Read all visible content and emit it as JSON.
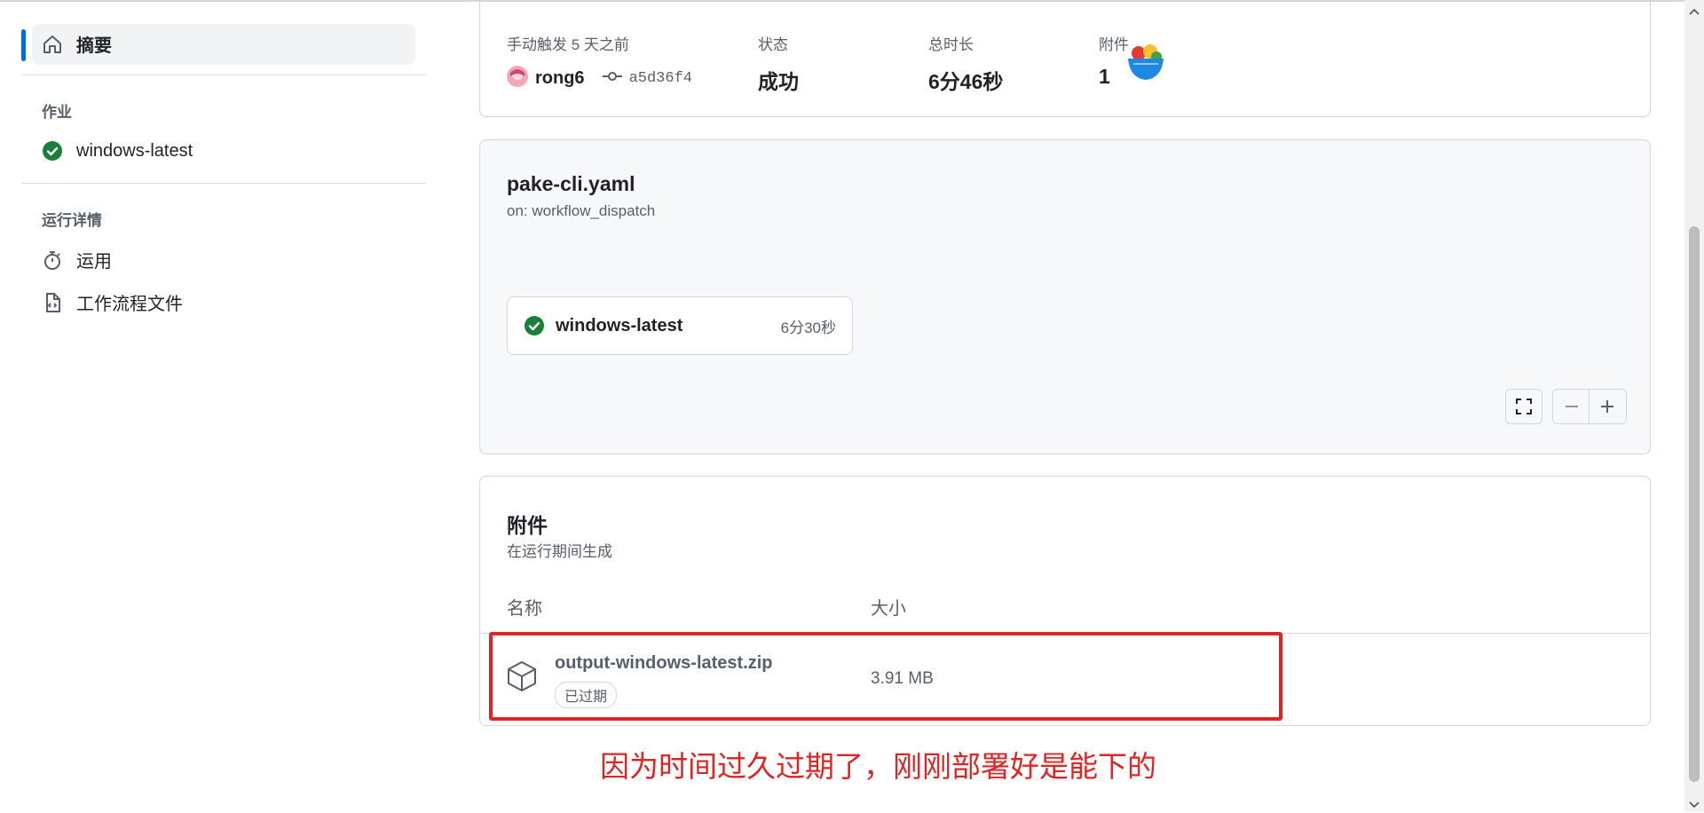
{
  "sidebar": {
    "summary_label": "摘要",
    "jobs_heading": "作业",
    "job_item": "windows-latest",
    "run_details_heading": "运行详情",
    "usage_label": "运用",
    "workflow_file_label": "工作流程文件"
  },
  "summary": {
    "trigger_label": "手动触发 5 天之前",
    "user": "rong6",
    "commit": "a5d36f4",
    "status_label": "状态",
    "status_value": "成功",
    "duration_label": "总时长",
    "duration_value": "6分46秒",
    "artifacts_label": "附件",
    "artifacts_value": "1"
  },
  "workflow": {
    "file": "pake-cli.yaml",
    "trigger": "on: workflow_dispatch",
    "job_name": "windows-latest",
    "job_duration": "6分30秒"
  },
  "artifacts": {
    "title": "附件",
    "subtitle": "在运行期间生成",
    "col_name": "名称",
    "col_size": "大小",
    "rows": [
      {
        "name": "output-windows-latest.zip",
        "status": "已过期",
        "size": "3.91 MB"
      }
    ]
  },
  "annotation": {
    "text": "因为时间过久过期了，刚刚部署好是能下的",
    "color": "#e02424"
  },
  "colors": {
    "success": "#1a7f37",
    "accent": "#0969da",
    "highlight_box": "#e02424"
  }
}
